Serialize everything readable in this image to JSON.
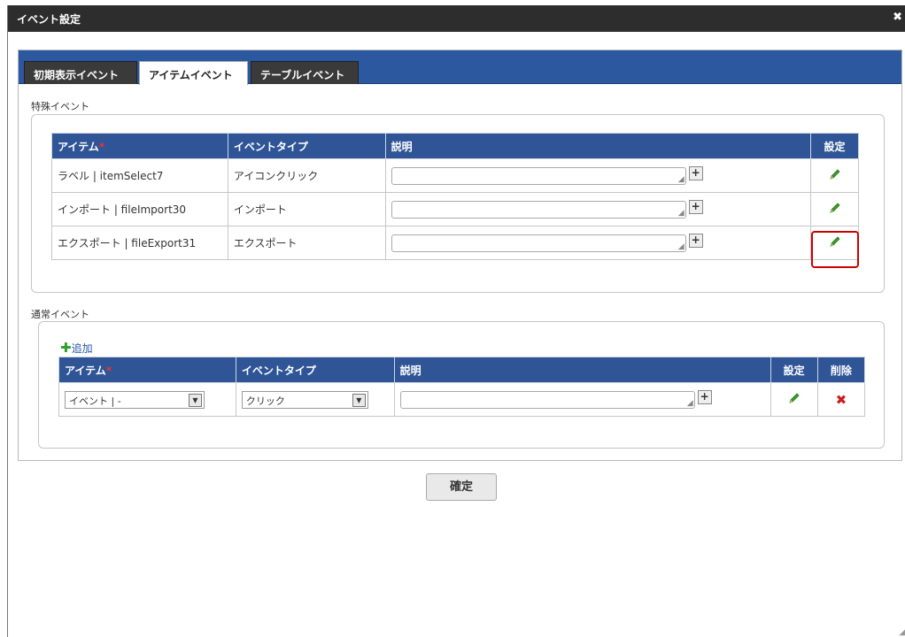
{
  "dialog": {
    "title": "イベント設定",
    "close_icon": "✖"
  },
  "tabs": [
    {
      "label": "初期表示イベント",
      "active": false
    },
    {
      "label": "アイテムイベント",
      "active": true
    },
    {
      "label": "テーブルイベント",
      "active": false
    }
  ],
  "special": {
    "label": "特殊イベント",
    "headers": {
      "item": "アイテム",
      "required": "*",
      "event_type": "イベントタイプ",
      "description": "説明",
      "settings": "設定"
    },
    "rows": [
      {
        "item": "ラベル | itemSelect7",
        "event_type": "アイコンクリック",
        "description": ""
      },
      {
        "item": "インポート | fileImport30",
        "event_type": "インポート",
        "description": ""
      },
      {
        "item": "エクスポート | fileExport31",
        "event_type": "エクスポート",
        "description": ""
      }
    ]
  },
  "normal": {
    "label": "通常イベント",
    "add_label": "追加",
    "headers": {
      "item": "アイテム",
      "required": "*",
      "event_type": "イベントタイプ",
      "description": "説明",
      "settings": "設定",
      "delete": "削除"
    },
    "rows": [
      {
        "item_select": "イベント | -",
        "event_type_select": "クリック",
        "description": ""
      }
    ]
  },
  "confirm_label": "確定",
  "colors": {
    "header_blue": "#2f5597",
    "tabbar_blue": "#2c58a0",
    "pencil_green": "#3a9b2a",
    "delete_red": "#c92020",
    "highlight_red": "#cc0000"
  }
}
